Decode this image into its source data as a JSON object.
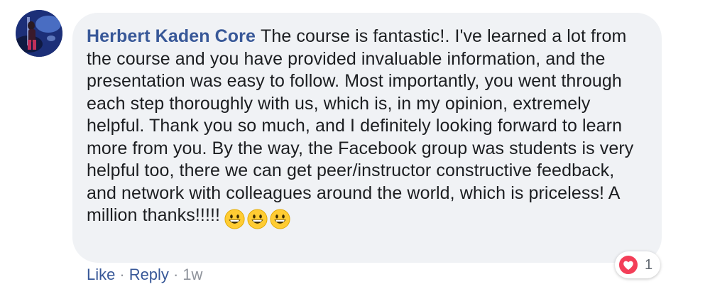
{
  "comment": {
    "author": "Herbert Kaden Core",
    "body": "The course is fantastic!. I've learned a lot from the course and you have provided invaluable information, and the presentation was easy to follow. Most importantly, you went through each step thoroughly with us, which is, in my opinion, extremely helpful. Thank you so much, and I definitely looking forward to learn more from you. By the way, the Facebook group was students is very helpful too, there we can get peer/instructor constructive feedback, and network with colleagues around the world, which is priceless! A million thanks!!!!!",
    "emojis": [
      "grinning-face",
      "grinning-face",
      "grinning-face"
    ],
    "reactions": {
      "icon": "heart-icon",
      "count": "1",
      "color": "#f33e58"
    }
  },
  "actions": {
    "like_label": "Like",
    "separator_1": "·",
    "reply_label": "Reply",
    "separator_2": "·",
    "timestamp": "1w"
  },
  "colors": {
    "bubble": "#f0f2f5",
    "author": "#385898",
    "text": "#1c1e21",
    "meta": "#90949c"
  }
}
